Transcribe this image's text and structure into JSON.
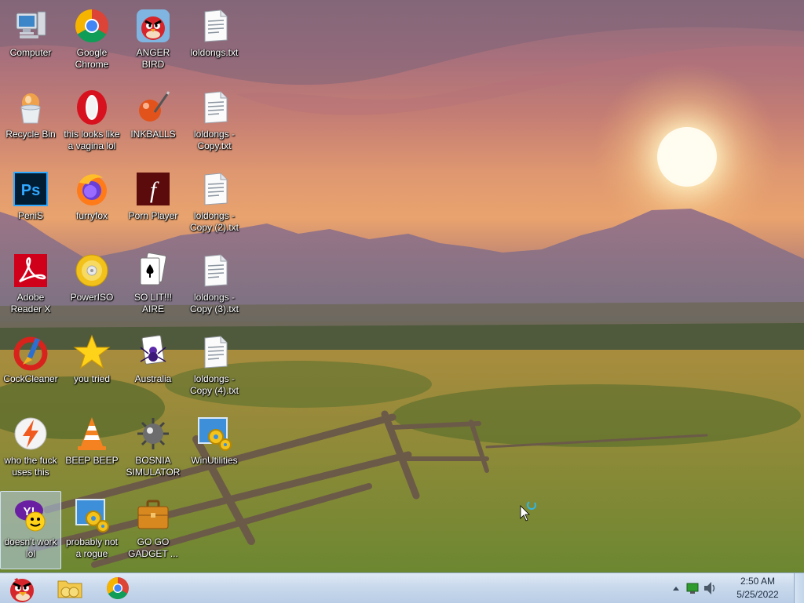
{
  "desktop": {
    "icons": [
      {
        "label": "Computer",
        "icon": "computer-icon"
      },
      {
        "label": "Google Chrome",
        "icon": "chrome-icon"
      },
      {
        "label": "ANGER BIRD",
        "icon": "angry-bird-icon"
      },
      {
        "label": "loldongs.txt",
        "icon": "text-file-icon"
      },
      {
        "label": "Recycle Bin",
        "icon": "recycle-bin-icon"
      },
      {
        "label": "this looks like a vagina lol",
        "icon": "opera-icon"
      },
      {
        "label": "INKBALLS",
        "icon": "inkball-icon"
      },
      {
        "label": "loldongs - Copy.txt",
        "icon": "text-file-icon"
      },
      {
        "label": "PeniS",
        "icon": "photoshop-icon"
      },
      {
        "label": "furryfox",
        "icon": "firefox-icon"
      },
      {
        "label": "Porn Player",
        "icon": "flash-icon"
      },
      {
        "label": "loldongs - Copy (2).txt",
        "icon": "text-file-icon"
      },
      {
        "label": "Adobe Reader X",
        "icon": "adobe-reader-icon"
      },
      {
        "label": "PowerISO",
        "icon": "disc-icon"
      },
      {
        "label": "SO LIT!!! AIRE",
        "icon": "solitaire-icon"
      },
      {
        "label": "loldongs - Copy (3).txt",
        "icon": "text-file-icon"
      },
      {
        "label": "CockCleaner",
        "icon": "ccleaner-icon"
      },
      {
        "label": "you tried",
        "icon": "star-icon"
      },
      {
        "label": "Australia",
        "icon": "spider-solitaire-icon"
      },
      {
        "label": "loldongs - Copy (4).txt",
        "icon": "text-file-icon"
      },
      {
        "label": "who the fuck uses this",
        "icon": "lightning-icon"
      },
      {
        "label": "BEEP BEEP",
        "icon": "vlc-cone-icon"
      },
      {
        "label": "BOSNIA SIMULATOR",
        "icon": "mine-icon"
      },
      {
        "label": "WinUtilities",
        "icon": "winutilities-icon"
      },
      {
        "label": "doesn't work lol",
        "icon": "yahoo-messenger-icon",
        "selected": true
      },
      {
        "label": "probably not a rogue",
        "icon": "winutilities-icon"
      },
      {
        "label": "GO GO GADGET ...",
        "icon": "briefcase-icon"
      }
    ]
  },
  "taskbar": {
    "start_icon": "angry-bird-start-icon",
    "pinned": [
      {
        "icon": "folder-icon",
        "name": "explorer"
      },
      {
        "icon": "chrome-icon",
        "name": "chrome"
      }
    ],
    "tray": {
      "icons": [
        "show-hidden-icons-arrow",
        "network-icon",
        "volume-icon"
      ]
    },
    "clock": {
      "time": "2:50 AM",
      "date": "5/25/2022"
    }
  }
}
